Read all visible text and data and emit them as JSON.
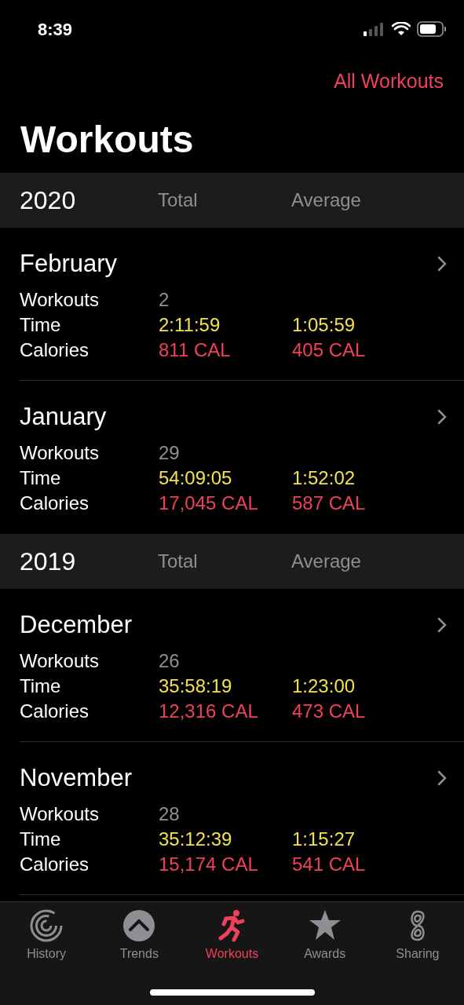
{
  "status_bar": {
    "time": "8:39"
  },
  "header": {
    "link": "All Workouts",
    "title": "Workouts"
  },
  "sections": [
    {
      "year": "2020",
      "total_label": "Total",
      "average_label": "Average",
      "months": [
        {
          "name": "February",
          "rows": [
            {
              "kind": "count",
              "label": "Workouts",
              "total": "2"
            },
            {
              "kind": "time",
              "label": "Time",
              "total": "2:11:59",
              "average": "1:05:59"
            },
            {
              "kind": "calories",
              "label": "Calories",
              "total": "811 CAL",
              "average": "405 CAL"
            }
          ]
        },
        {
          "name": "January",
          "rows": [
            {
              "kind": "count",
              "label": "Workouts",
              "total": "29"
            },
            {
              "kind": "time",
              "label": "Time",
              "total": "54:09:05",
              "average": "1:52:02"
            },
            {
              "kind": "calories",
              "label": "Calories",
              "total": "17,045 CAL",
              "average": "587 CAL"
            }
          ]
        }
      ]
    },
    {
      "year": "2019",
      "total_label": "Total",
      "average_label": "Average",
      "months": [
        {
          "name": "December",
          "rows": [
            {
              "kind": "count",
              "label": "Workouts",
              "total": "26"
            },
            {
              "kind": "time",
              "label": "Time",
              "total": "35:58:19",
              "average": "1:23:00"
            },
            {
              "kind": "calories",
              "label": "Calories",
              "total": "12,316 CAL",
              "average": "473 CAL"
            }
          ]
        },
        {
          "name": "November",
          "rows": [
            {
              "kind": "count",
              "label": "Workouts",
              "total": "28"
            },
            {
              "kind": "time",
              "label": "Time",
              "total": "35:12:39",
              "average": "1:15:27"
            },
            {
              "kind": "calories",
              "label": "Calories",
              "total": "15,174 CAL",
              "average": "541 CAL"
            }
          ]
        }
      ]
    }
  ],
  "tabs": [
    {
      "kind": "history",
      "label": "History",
      "selected": false
    },
    {
      "kind": "trends",
      "label": "Trends",
      "selected": false
    },
    {
      "kind": "workouts",
      "label": "Workouts",
      "selected": true
    },
    {
      "kind": "awards",
      "label": "Awards",
      "selected": false
    },
    {
      "kind": "sharing",
      "label": "Sharing",
      "selected": false
    }
  ]
}
